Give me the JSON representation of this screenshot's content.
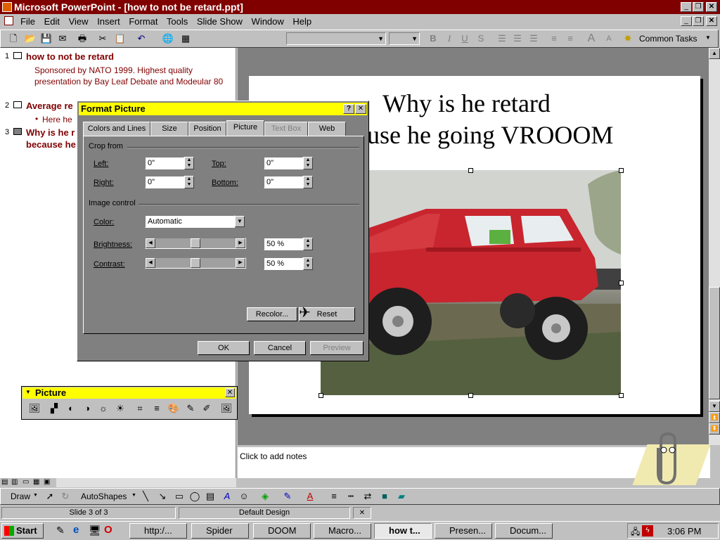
{
  "app": {
    "title": "Microsoft PowerPoint - [how to not be retard.ppt]",
    "menu": [
      "File",
      "Edit",
      "View",
      "Insert",
      "Format",
      "Tools",
      "Slide Show",
      "Window",
      "Help"
    ],
    "common_tasks": "Common Tasks"
  },
  "outline": {
    "slides": [
      {
        "num": "1",
        "title": "how to not be retard",
        "body": "Sponsored by NATO 1999. Highest quality presentation by Bay Leaf Debate and Modeular 80"
      },
      {
        "num": "2",
        "title": "Average re",
        "bullet": "Here he"
      },
      {
        "num": "3",
        "title": "Why is he r",
        "title2": "because he"
      }
    ]
  },
  "slide": {
    "line1": "Why is he retard",
    "line2": "use he going VROOOM"
  },
  "notes_placeholder": "Click to add notes",
  "dialog": {
    "title": "Format Picture",
    "tabs": [
      "Colors and Lines",
      "Size",
      "Position",
      "Picture",
      "Text Box",
      "Web"
    ],
    "crop_from": "Crop from",
    "left_label": "Left:",
    "left_value": "0\"",
    "top_label": "Top:",
    "top_value": "0\"",
    "right_label": "Right:",
    "right_value": "0\"",
    "bottom_label": "Bottom:",
    "bottom_value": "0\"",
    "image_control": "Image control",
    "color_label": "Color:",
    "color_value": "Automatic",
    "brightness_label": "Brightness:",
    "brightness_value": "50 %",
    "brightness_level": 0.5,
    "contrast_label": "Contrast:",
    "contrast_value": "50 %",
    "contrast_level": 0.5,
    "recolor": "Recolor...",
    "reset": "Reset",
    "ok": "OK",
    "cancel": "Cancel",
    "preview": "Preview"
  },
  "picture_toolbar": {
    "title": "Picture"
  },
  "drawing_toolbar": {
    "draw": "Draw",
    "autoshapes": "AutoShapes"
  },
  "status": {
    "slide": "Slide 3 of 3",
    "design": "Default Design"
  },
  "taskbar": {
    "start": "Start",
    "buttons": [
      "http:/...",
      "Spider",
      "DOOM",
      "Macro...",
      "how t...",
      "Presen...",
      "Docum..."
    ],
    "clock": "3:06 PM"
  },
  "colors": {
    "title_bar": "#800000",
    "dialog_title": "#ffff00",
    "outline_text": "#800000"
  }
}
